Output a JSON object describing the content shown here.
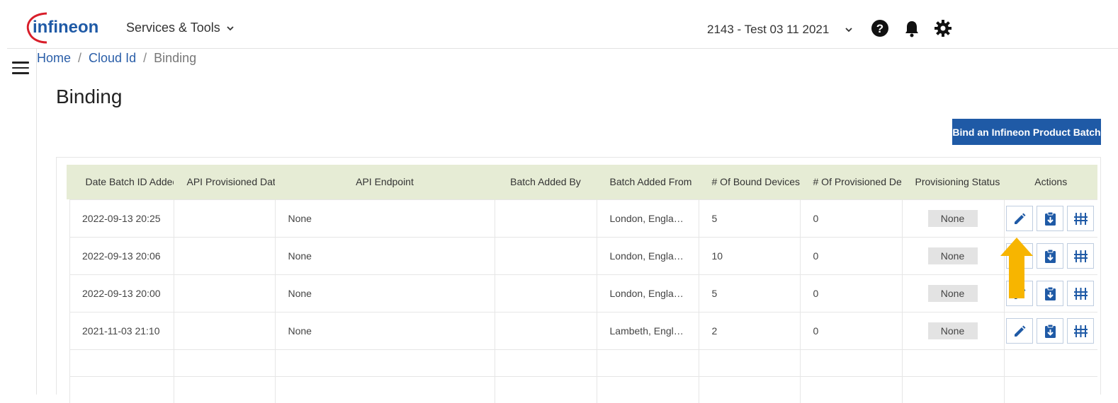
{
  "brand": {
    "logo_text": "infineon",
    "color": "#1f5aa6",
    "logo_red": "#d81e2a"
  },
  "topbar": {
    "services_label": "Services & Tools",
    "project_label": "2143 - Test 03 11 2021",
    "icons": [
      "help-icon",
      "bell-icon",
      "gear-icon"
    ]
  },
  "breadcrumb": {
    "home": "Home",
    "cloud_id": "Cloud Id",
    "current": "Binding",
    "separator": "/"
  },
  "page": {
    "title": "Binding",
    "bind_button_label": "Bind an Infineon Product Batch"
  },
  "table": {
    "headers": {
      "date": "Date Batch ID Added",
      "api_date": "API Provisioned Date",
      "api_endpoint": "API Endpoint",
      "added_by": "Batch Added By",
      "added_from": "Batch Added From",
      "bound": "# Of Bound Devices",
      "provisioned": "# Of Provisioned Dev",
      "status": "Provisioning Status",
      "actions": "Actions"
    },
    "rows": [
      {
        "date": "2022-09-13 20:25",
        "api_date": "",
        "api_endpoint": "None",
        "added_by": "",
        "added_from": "London, Engla…",
        "bound": "5",
        "provisioned": "0",
        "status": "None"
      },
      {
        "date": "2022-09-13 20:06",
        "api_date": "",
        "api_endpoint": "None",
        "added_by": "",
        "added_from": "London, Engla…",
        "bound": "10",
        "provisioned": "0",
        "status": "None"
      },
      {
        "date": "2022-09-13 20:00",
        "api_date": "",
        "api_endpoint": "None",
        "added_by": "",
        "added_from": "London, Engla…",
        "bound": "5",
        "provisioned": "0",
        "status": "None"
      },
      {
        "date": "2021-11-03 21:10",
        "api_date": "",
        "api_endpoint": "None",
        "added_by": "",
        "added_from": "Lambeth, Engl…",
        "bound": "2",
        "provisioned": "0",
        "status": "None"
      }
    ],
    "action_icons": [
      "edit-icon",
      "clipboard-download-icon",
      "sliders-icon"
    ]
  },
  "annotation": {
    "arrow_color": "#f7b500"
  }
}
